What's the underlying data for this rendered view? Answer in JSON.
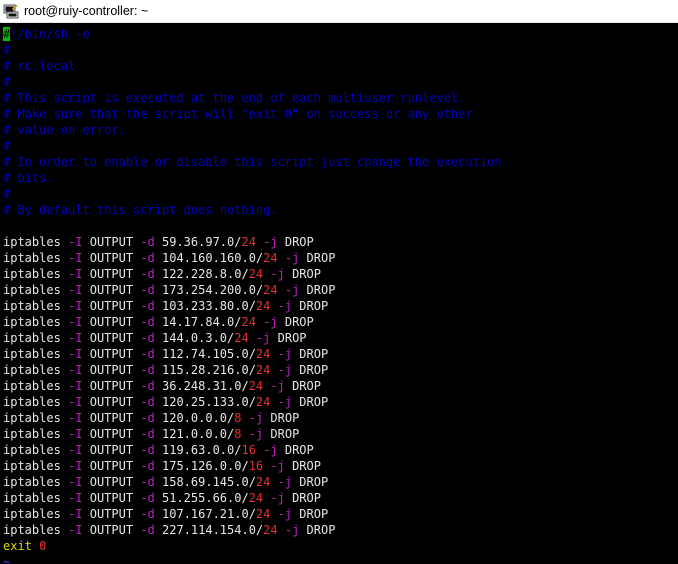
{
  "window": {
    "title": "root@ruiy-controller: ~",
    "icon": "putty-terminal-icon"
  },
  "colors": {
    "background": "#000000",
    "comment": "#0000c8",
    "command": "#e6e6e6",
    "flag": "#c020c0",
    "number": "#e03030",
    "keyword": "#d8d800",
    "cursor": "#00c000"
  },
  "file": {
    "shebang_cursor": "#",
    "shebang_rest": "!/bin/sh -e",
    "comments": [
      "#",
      "# rc.local",
      "#",
      "# This script is executed at the end of each multiuser runlevel.",
      "# Make sure that the script will \"exit 0\" on success or any other",
      "# value on error.",
      "#",
      "# In order to enable or disable this script just change the execution",
      "# bits.",
      "#",
      "# By default this script does nothing."
    ],
    "rules": [
      {
        "cmd": "iptables",
        "f1": "-I",
        "chain": "OUTPUT",
        "f2": "-d",
        "ip": "59.36.97.0/",
        "mask": "24",
        "f3": "-j",
        "target": "DROP"
      },
      {
        "cmd": "iptables",
        "f1": "-I",
        "chain": "OUTPUT",
        "f2": "-d",
        "ip": "104.160.160.0/",
        "mask": "24",
        "f3": "-j",
        "target": "DROP"
      },
      {
        "cmd": "iptables",
        "f1": "-I",
        "chain": "OUTPUT",
        "f2": "-d",
        "ip": "122.228.8.0/",
        "mask": "24",
        "f3": "-j",
        "target": "DROP"
      },
      {
        "cmd": "iptables",
        "f1": "-I",
        "chain": "OUTPUT",
        "f2": "-d",
        "ip": "173.254.200.0/",
        "mask": "24",
        "f3": "-j",
        "target": "DROP"
      },
      {
        "cmd": "iptables",
        "f1": "-I",
        "chain": "OUTPUT",
        "f2": "-d",
        "ip": "103.233.80.0/",
        "mask": "24",
        "f3": "-j",
        "target": "DROP"
      },
      {
        "cmd": "iptables",
        "f1": "-I",
        "chain": "OUTPUT",
        "f2": "-d",
        "ip": "14.17.84.0/",
        "mask": "24",
        "f3": "-j",
        "target": "DROP"
      },
      {
        "cmd": "iptables",
        "f1": "-I",
        "chain": "OUTPUT",
        "f2": "-d",
        "ip": "144.0.3.0/",
        "mask": "24",
        "f3": "-j",
        "target": "DROP"
      },
      {
        "cmd": "iptables",
        "f1": "-I",
        "chain": "OUTPUT",
        "f2": "-d",
        "ip": "112.74.105.0/",
        "mask": "24",
        "f3": "-j",
        "target": "DROP"
      },
      {
        "cmd": "iptables",
        "f1": "-I",
        "chain": "OUTPUT",
        "f2": "-d",
        "ip": "115.28.216.0/",
        "mask": "24",
        "f3": "-j",
        "target": "DROP"
      },
      {
        "cmd": "iptables",
        "f1": "-I",
        "chain": "OUTPUT",
        "f2": "-d",
        "ip": "36.248.31.0/",
        "mask": "24",
        "f3": "-j",
        "target": "DROP"
      },
      {
        "cmd": "iptables",
        "f1": "-I",
        "chain": "OUTPUT",
        "f2": "-d",
        "ip": "120.25.133.0/",
        "mask": "24",
        "f3": "-j",
        "target": "DROP"
      },
      {
        "cmd": "iptables",
        "f1": "-I",
        "chain": "OUTPUT",
        "f2": "-d",
        "ip": "120.0.0.0/",
        "mask": "8",
        "f3": "-j",
        "target": "DROP"
      },
      {
        "cmd": "iptables",
        "f1": "-I",
        "chain": "OUTPUT",
        "f2": "-d",
        "ip": "121.0.0.0/",
        "mask": "8",
        "f3": "-j",
        "target": "DROP"
      },
      {
        "cmd": "iptables",
        "f1": "-I",
        "chain": "OUTPUT",
        "f2": "-d",
        "ip": "119.63.0.0/",
        "mask": "16",
        "f3": "-j",
        "target": "DROP"
      },
      {
        "cmd": "iptables",
        "f1": "-I",
        "chain": "OUTPUT",
        "f2": "-d",
        "ip": "175.126.0.0/",
        "mask": "16",
        "f3": "-j",
        "target": "DROP"
      },
      {
        "cmd": "iptables",
        "f1": "-I",
        "chain": "OUTPUT",
        "f2": "-d",
        "ip": "158.69.145.0/",
        "mask": "24",
        "f3": "-j",
        "target": "DROP"
      },
      {
        "cmd": "iptables",
        "f1": "-I",
        "chain": "OUTPUT",
        "f2": "-d",
        "ip": "51.255.66.0/",
        "mask": "24",
        "f3": "-j",
        "target": "DROP"
      },
      {
        "cmd": "iptables",
        "f1": "-I",
        "chain": "OUTPUT",
        "f2": "-d",
        "ip": "107.167.21.0/",
        "mask": "24",
        "f3": "-j",
        "target": "DROP"
      },
      {
        "cmd": "iptables",
        "f1": "-I",
        "chain": "OUTPUT",
        "f2": "-d",
        "ip": "227.114.154.0/",
        "mask": "24",
        "f3": "-j",
        "target": "DROP"
      }
    ],
    "exit_keyword": "exit",
    "exit_code": "0",
    "tildes": [
      "~"
    ]
  }
}
